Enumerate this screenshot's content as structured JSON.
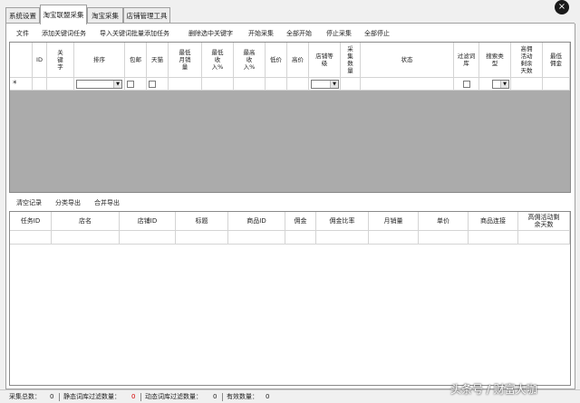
{
  "tabs": [
    "系统设置",
    "淘宝联盟采集",
    "淘宝采集",
    "店铺管理工具"
  ],
  "active_tab": 1,
  "toolbar_top": [
    "文件",
    "添加关键词任务",
    "导入关键词批量添加任务",
    "删除选中关键字",
    "开始采集",
    "全部开始",
    "停止采集",
    "全部停止"
  ],
  "grid_top": {
    "columns": [
      [
        "ID"
      ],
      [
        "关",
        "键",
        "字"
      ],
      [
        "排序"
      ],
      [
        "包邮"
      ],
      [
        "天猫"
      ],
      [
        "最低",
        "月销",
        "量"
      ],
      [
        "最低",
        "收",
        "入%"
      ],
      [
        "最高",
        "收",
        "入%"
      ],
      [
        "低价"
      ],
      [
        "高价"
      ],
      [
        "店铺等",
        "级"
      ],
      [
        "采",
        "集",
        "数",
        "量"
      ],
      [
        "状态"
      ],
      [
        "过滤词",
        "库"
      ],
      [
        "搜索类",
        "型"
      ],
      [
        "高佣",
        "活动",
        "剩余",
        "天数"
      ],
      [
        "最低",
        "佣金"
      ]
    ],
    "new_row_marker": "*"
  },
  "toolbar_bottom": [
    "清空记录",
    "分类导出",
    "合并导出"
  ],
  "grid_bottom": {
    "columns": [
      [
        "任务ID"
      ],
      [
        "店名"
      ],
      [
        "店铺ID"
      ],
      [
        "标题"
      ],
      [
        "商品ID"
      ],
      [
        "佣金"
      ],
      [
        "佣金比率"
      ],
      [
        "月销量"
      ],
      [
        "单价"
      ],
      [
        "商品连接"
      ],
      [
        "高佣活动剩",
        "余天数"
      ]
    ]
  },
  "status": {
    "total_label": "采集总数：",
    "total_value": "0",
    "static_label": "静态词库过滤数量：",
    "static_value": "0",
    "dynamic_label": "动态词库过滤数量：",
    "dynamic_value": "0",
    "valid_label": "有效数量：",
    "valid_value": "0"
  },
  "watermark": "头条号 / 财富大咖",
  "close_glyph": "×"
}
